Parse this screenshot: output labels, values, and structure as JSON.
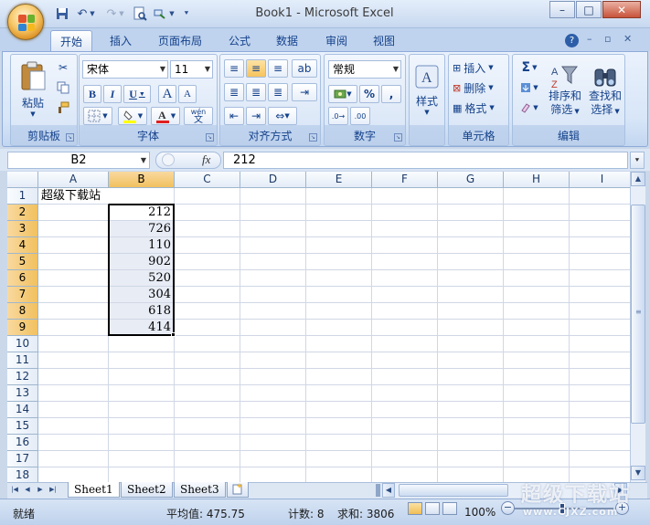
{
  "app": {
    "title": "Book1 - Microsoft Excel"
  },
  "ribbon": {
    "tabs": [
      "开始",
      "插入",
      "页面布局",
      "公式",
      "数据",
      "审阅",
      "视图"
    ],
    "active_tab": "开始",
    "clipboard": {
      "label": "剪贴板",
      "paste": "粘贴"
    },
    "font": {
      "label": "字体",
      "name": "宋体",
      "size": "11",
      "bold": "B",
      "italic": "I",
      "underline": "U",
      "grow": "A",
      "shrink": "A",
      "phonetic": "wén"
    },
    "alignment": {
      "label": "对齐方式"
    },
    "number": {
      "label": "数字",
      "format": "常规",
      "percent": "%",
      "comma": ","
    },
    "styles": {
      "label": "样式"
    },
    "cells": {
      "label": "单元格",
      "insert": "插入",
      "delete": "删除",
      "format": "格式"
    },
    "editing": {
      "label": "编辑",
      "sort_filter": "排序和筛选",
      "find_select": "查找和选择",
      "sort_line1": "排序和",
      "sort_line2": "筛选",
      "find_line1": "查找和",
      "find_line2": "选择"
    }
  },
  "formula_bar": {
    "name_box": "B2",
    "fx": "fx",
    "value": "212"
  },
  "sheet": {
    "columns": [
      "A",
      "B",
      "C",
      "D",
      "E",
      "F",
      "G",
      "H",
      "I"
    ],
    "selected_column": "B",
    "rows": [
      "1",
      "2",
      "3",
      "4",
      "5",
      "6",
      "7",
      "8",
      "9",
      "10",
      "11",
      "12",
      "13",
      "14",
      "15",
      "16",
      "17",
      "18"
    ],
    "a1": "超级下载站",
    "b_values": [
      "212",
      "726",
      "110",
      "902",
      "520",
      "304",
      "618",
      "414"
    ]
  },
  "sheet_tabs": [
    "Sheet1",
    "Sheet2",
    "Sheet3"
  ],
  "active_sheet": "Sheet1",
  "status": {
    "mode": "就绪",
    "average": "平均值: 475.75",
    "count": "计数: 8",
    "sum": "求和: 3806",
    "zoom": "100%"
  },
  "watermark": {
    "line1": "超级下载站",
    "line2": "www.CJXZ.com"
  }
}
